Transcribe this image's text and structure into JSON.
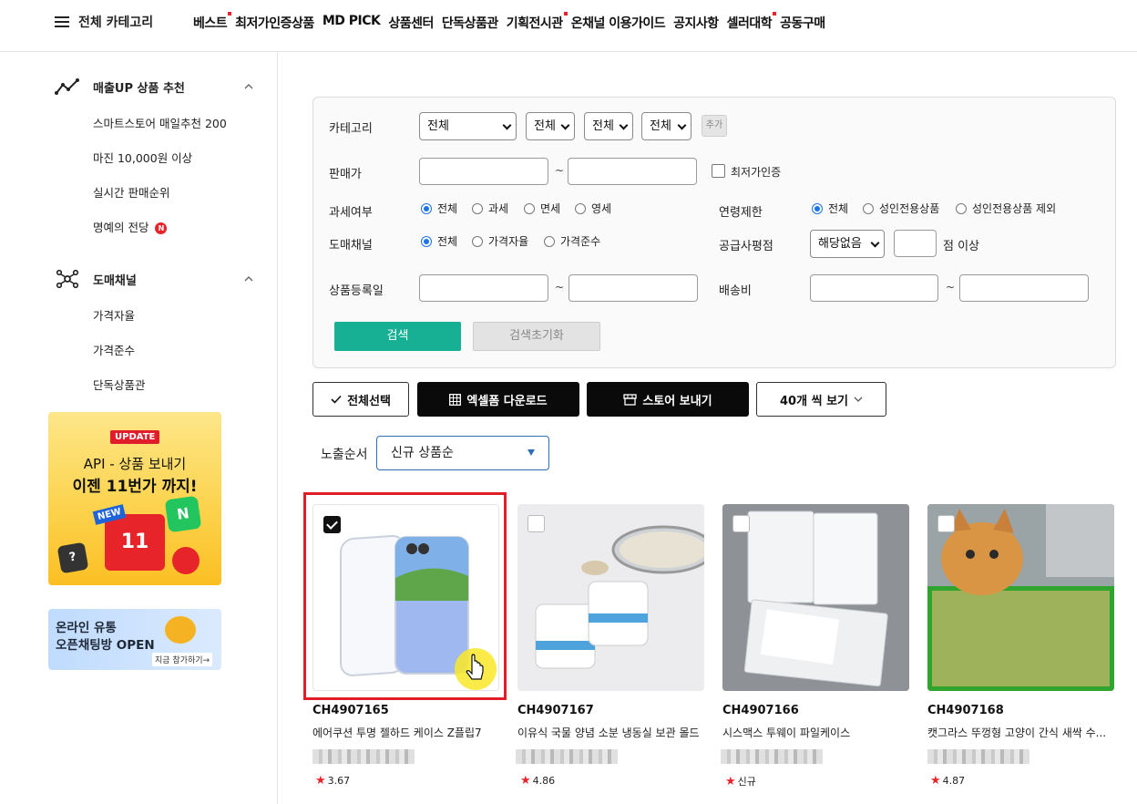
{
  "topnav": {
    "category_label": "전체 카테고리",
    "menu": [
      {
        "label": "베스트",
        "dot": true
      },
      {
        "label": "최저가인증상품",
        "dot": false
      },
      {
        "label": "MD PICK",
        "dot": false
      },
      {
        "label": "상품센터",
        "dot": false
      },
      {
        "label": "단독상품관",
        "dot": false
      },
      {
        "label": "기획전시관",
        "dot": true
      },
      {
        "label": "온채널 이용가이드",
        "dot": false
      },
      {
        "label": "공지사항",
        "dot": false
      },
      {
        "label": "셀러대학",
        "dot": true
      },
      {
        "label": "공동구매",
        "dot": false
      }
    ]
  },
  "sidebar": {
    "sections": [
      {
        "title": "매출UP 상품 추천",
        "icon": "trend-chart-icon",
        "items": [
          "스마트스토어 매일추천 200",
          "마진 10,000원 이상",
          "실시간 판매순위",
          "명예의 전당"
        ]
      },
      {
        "title": "도매채널",
        "icon": "network-icon",
        "items": [
          "가격자율",
          "가격준수",
          "단독상품관"
        ]
      }
    ],
    "new_badge": "N",
    "banner1": {
      "tag": "UPDATE",
      "line1": "API - 상품 보내기",
      "line2": "이젠 11번가 까지!",
      "new": "NEW",
      "brand": "11",
      "green": "N",
      "q": "?"
    },
    "banner2": {
      "line1": "온라인 유통",
      "line2": "오픈채팅방 OPEN",
      "cta": "지금 참가하기→"
    }
  },
  "filter": {
    "category_label": "카테고리",
    "category_selects": [
      "전체",
      "전체",
      "전체",
      "전체"
    ],
    "add_label": "추가",
    "price_label": "판매가",
    "tilde": "~",
    "lowest_price_label": "최저가인증",
    "tax_label": "과세여부",
    "tax_options": [
      "전체",
      "과세",
      "면세",
      "영세"
    ],
    "age_label": "연령제한",
    "age_options": [
      "전체",
      "성인전용상품",
      "성인전용상품 제외"
    ],
    "channel_label": "도매채널",
    "channel_options": [
      "전체",
      "가격자율",
      "가격준수"
    ],
    "supplier_label": "공급사평점",
    "supplier_select": "해당없음",
    "supplier_suffix": "점 이상",
    "regdate_label": "상품등록일",
    "shipping_label": "배송비",
    "search_label": "검색",
    "reset_label": "검색초기화"
  },
  "actions": {
    "select_all": "전체선택",
    "excel": "엑셀폼 다운로드",
    "send_store": "스토어 보내기",
    "per_page": "40개 씩 보기"
  },
  "sort": {
    "label": "노출순서",
    "value": "신규 상품순"
  },
  "products": [
    {
      "code": "CH4907165",
      "name": "에어쿠션 투명 젤하드 케이스 Z플립7",
      "rating": "3.67",
      "checked": true
    },
    {
      "code": "CH4907167",
      "name": "이유식 국물 양념 소분 냉동실 보관 몰드",
      "rating": "4.86",
      "checked": false
    },
    {
      "code": "CH4907166",
      "name": "시스맥스 투웨이 파일케이스",
      "rating": "신규",
      "checked": false
    },
    {
      "code": "CH4907168",
      "name": "캣그라스 뚜껑형 고양이 간식 새싹 수...",
      "rating": "4.87",
      "checked": false
    }
  ]
}
